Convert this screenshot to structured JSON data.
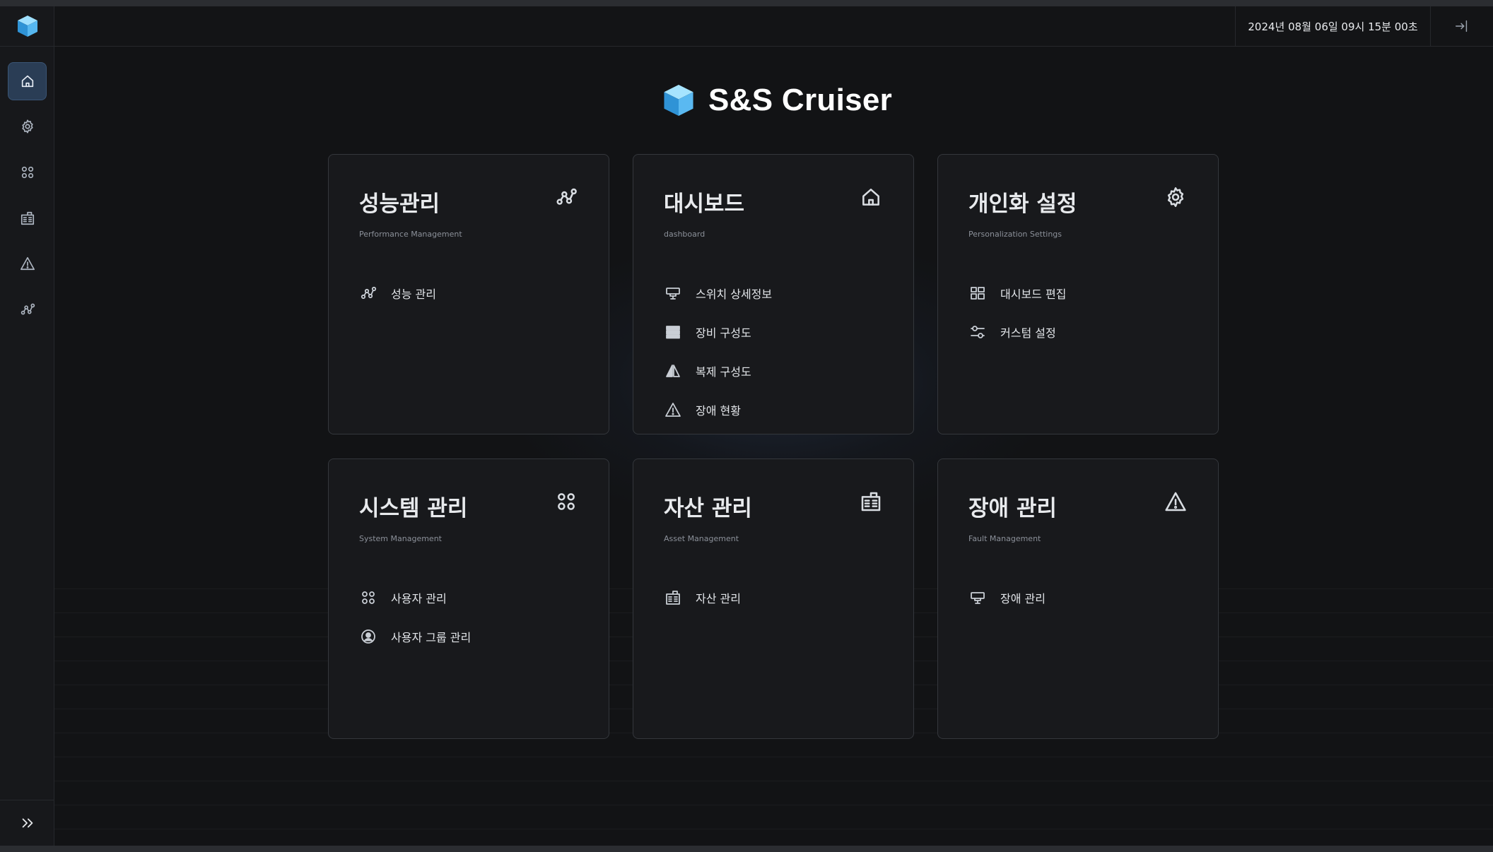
{
  "app": {
    "title": "S&S Cruiser"
  },
  "topbar": {
    "datetime": "2024년 08월 06일 09시 15분 00초"
  },
  "sidebar": {
    "items": [
      {
        "name": "home-icon",
        "active": true
      },
      {
        "name": "gear-icon",
        "active": false
      },
      {
        "name": "apps-icon",
        "active": false
      },
      {
        "name": "building-icon",
        "active": false
      },
      {
        "name": "warning-icon",
        "active": false
      },
      {
        "name": "chart-network-icon",
        "active": false
      }
    ],
    "expand_icon": "double-chevron-right-icon"
  },
  "cards": [
    {
      "title": "성능관리",
      "subtitle": "Performance Management",
      "icon": "chart-network-icon",
      "items": [
        {
          "label": "성능 관리",
          "icon": "chart-network-icon"
        }
      ]
    },
    {
      "title": "대시보드",
      "subtitle": "dashboard",
      "icon": "home-icon",
      "items": [
        {
          "label": "스위치 상세정보",
          "icon": "switch-icon"
        },
        {
          "label": "장비 구성도",
          "icon": "server-icon"
        },
        {
          "label": "복제 구성도",
          "icon": "replication-icon"
        },
        {
          "label": "장애 현황",
          "icon": "warning-icon"
        }
      ]
    },
    {
      "title": "개인화 설정",
      "subtitle": "Personalization Settings",
      "icon": "gear-icon",
      "items": [
        {
          "label": "대시보드 편집",
          "icon": "dashboard-grid-icon"
        },
        {
          "label": "커스텀 설정",
          "icon": "sliders-icon"
        }
      ]
    },
    {
      "title": "시스템 관리",
      "subtitle": "System Management",
      "icon": "apps-icon",
      "items": [
        {
          "label": "사용자 관리",
          "icon": "apps-icon"
        },
        {
          "label": "사용자 그룹 관리",
          "icon": "user-circle-icon"
        }
      ]
    },
    {
      "title": "자산 관리",
      "subtitle": "Asset Management",
      "icon": "building-icon",
      "items": [
        {
          "label": "자산 관리",
          "icon": "building-icon"
        }
      ]
    },
    {
      "title": "장애 관리",
      "subtitle": "Fault Management",
      "icon": "warning-icon",
      "items": [
        {
          "label": "장애 관리",
          "icon": "switch-icon"
        }
      ]
    }
  ],
  "colors": {
    "accent": "#2a3d55",
    "background": "#121315",
    "card": "#18191c"
  }
}
